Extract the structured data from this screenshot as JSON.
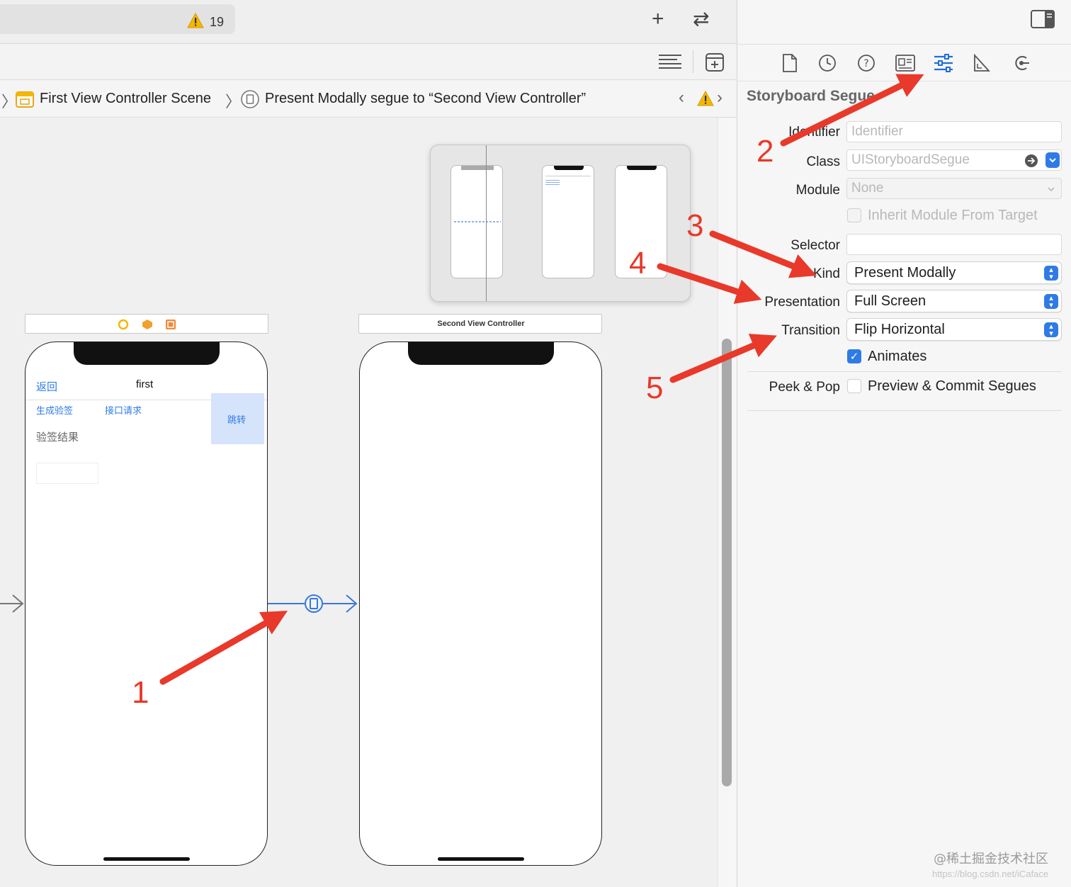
{
  "toolbar": {
    "warning_count": "19",
    "add_icon": "plus-icon",
    "swap_icon": "swap-arrows-icon",
    "inspector_toggle_icon": "sidebar-right-icon"
  },
  "jump_bar": {
    "scene": "First View Controller Scene",
    "segue": "Present Modally segue to “Second View Controller”"
  },
  "first_scene": {
    "back": "返回",
    "title": "first",
    "btn_generate": "生成验签",
    "btn_request": "接口请求",
    "btn_jump": "跳转",
    "result_label": "验签结果"
  },
  "second_scene": {
    "title": "Second View Controller"
  },
  "inspector": {
    "section_title": "Storyboard Segue",
    "identifier_label": "Identifier",
    "identifier_placeholder": "Identifier",
    "class_label": "Class",
    "class_placeholder": "UIStoryboardSegue",
    "module_label": "Module",
    "module_placeholder": "None",
    "inherit_label": "Inherit Module From Target",
    "selector_label": "Selector",
    "kind_label": "Kind",
    "kind_value": "Present Modally",
    "presentation_label": "Presentation",
    "presentation_value": "Full Screen",
    "transition_label": "Transition",
    "transition_value": "Flip Horizontal",
    "animates_label": "Animates",
    "animates_checked": true,
    "peek_label": "Peek & Pop",
    "peek_value": "Preview & Commit Segues",
    "accent_color": "#2f7be6"
  },
  "annotations": [
    "1",
    "2",
    "3",
    "4",
    "5"
  ],
  "annotation_color": "#e8392a",
  "watermark": "@稀土掘金技术社区",
  "watermark_url": "https://blog.csdn.net/iCaface"
}
